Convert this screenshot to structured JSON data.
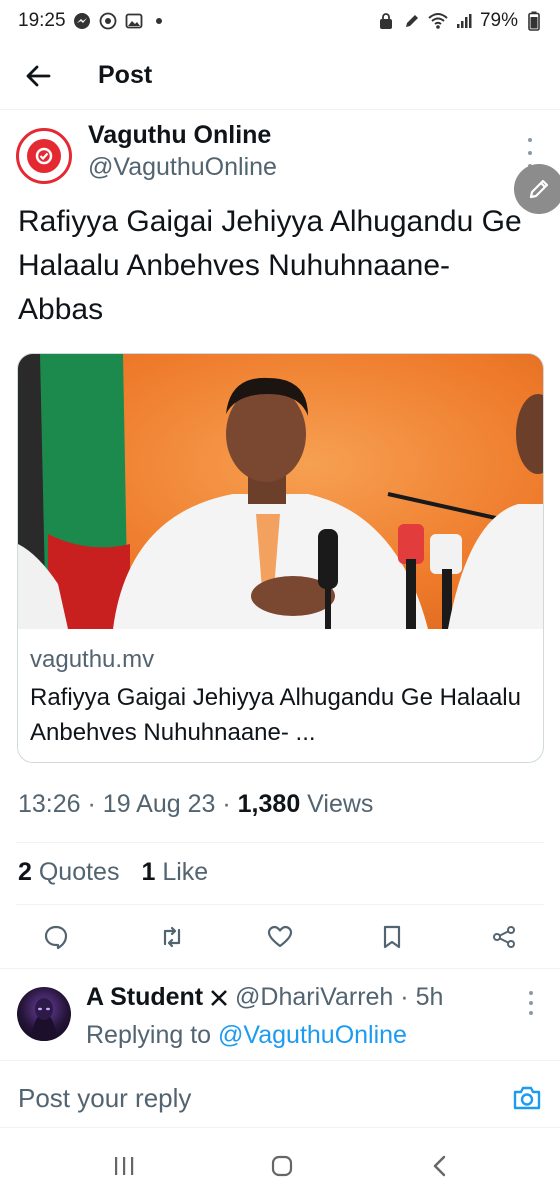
{
  "status_bar": {
    "time": "19:25",
    "battery": "79%"
  },
  "header": {
    "title": "Post"
  },
  "tweet": {
    "author_name": "Vaguthu Online",
    "author_handle": "@VaguthuOnline",
    "text": "Rafiyya Gaigai Jehiyya Alhugandu Ge Halaalu Anbehves Nuhuhnaane- Abbas",
    "card": {
      "domain": "vaguthu.mv",
      "title": "Rafiyya Gaigai Jehiyya Alhugandu Ge Halaalu Anbehves Nuhuhnaane- ..."
    },
    "meta": {
      "time": "13:26",
      "date": "19 Aug 23",
      "views_count": "1,380",
      "views_label": "Views"
    },
    "stats": {
      "quotes_count": "2",
      "quotes_label": "Quotes",
      "likes_count": "1",
      "likes_label": "Like"
    }
  },
  "reply": {
    "name": "A Student",
    "handle": "@DhariVarreh",
    "time": "5h",
    "replying_prefix": "Replying to",
    "replying_to": "@VaguthuOnline"
  },
  "compose": {
    "placeholder": "Post your reply"
  },
  "colors": {
    "accent": "#1d9bf0",
    "brand_red": "#e52933",
    "card_orange": "#f07f2a"
  },
  "icons": {
    "back": "arrow-left-icon",
    "reply": "reply-icon",
    "repost": "repost-icon",
    "like": "heart-icon",
    "bookmark": "bookmark-icon",
    "share": "share-icon",
    "camera": "camera-icon",
    "compose": "pencil-icon"
  }
}
